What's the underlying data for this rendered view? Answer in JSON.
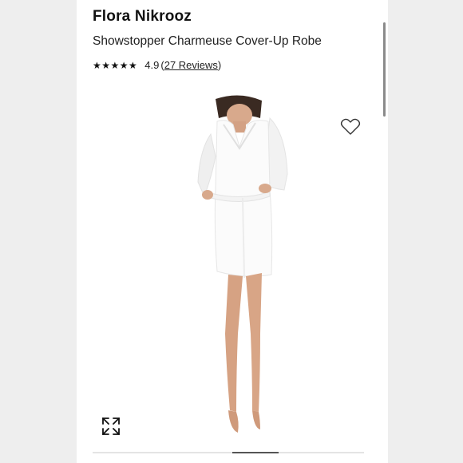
{
  "product": {
    "brand": "Flora Nikrooz",
    "name": "Showstopper Charmeuse Cover-Up Robe",
    "rating": {
      "stars": "★★★★★",
      "value": "4.9",
      "open_paren": "(",
      "reviews_text": "27 Reviews",
      "close_paren": ")",
      "stars_out_of_5": 4.9
    }
  },
  "gallery": {
    "image_subject": "model-wearing-white-robe",
    "carousel_position": 0.5
  },
  "icons": {
    "wishlist": "heart-icon",
    "expand": "expand-icon"
  },
  "colors": {
    "background": "#ffffff",
    "text": "#111111",
    "robe": "#fbfbfb"
  }
}
